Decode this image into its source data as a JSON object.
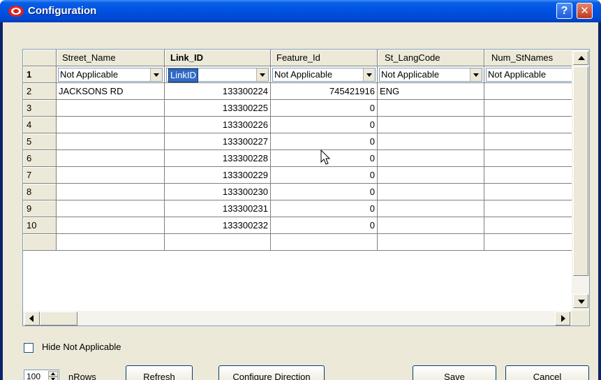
{
  "window": {
    "title": "Configuration",
    "help_label": "?",
    "close_label": "✕"
  },
  "grid": {
    "columns": [
      "Street_Name",
      "Link_ID",
      "Feature_Id",
      "St_LangCode",
      "Num_StNames"
    ],
    "mapping_row": {
      "row_number": "1",
      "values": [
        "Not Applicable",
        "LinkID",
        "Not Applicable",
        "Not Applicable",
        "Not Applicable"
      ]
    },
    "rows": [
      {
        "row_number": "2",
        "street_name": "JACKSONS RD",
        "link_id": "133300224",
        "feature_id": "745421916",
        "lang_code": "ENG"
      },
      {
        "row_number": "3",
        "street_name": "",
        "link_id": "133300225",
        "feature_id": "0",
        "lang_code": ""
      },
      {
        "row_number": "4",
        "street_name": "",
        "link_id": "133300226",
        "feature_id": "0",
        "lang_code": ""
      },
      {
        "row_number": "5",
        "street_name": "",
        "link_id": "133300227",
        "feature_id": "0",
        "lang_code": ""
      },
      {
        "row_number": "6",
        "street_name": "",
        "link_id": "133300228",
        "feature_id": "0",
        "lang_code": ""
      },
      {
        "row_number": "7",
        "street_name": "",
        "link_id": "133300229",
        "feature_id": "0",
        "lang_code": ""
      },
      {
        "row_number": "8",
        "street_name": "",
        "link_id": "133300230",
        "feature_id": "0",
        "lang_code": ""
      },
      {
        "row_number": "9",
        "street_name": "",
        "link_id": "133300231",
        "feature_id": "0",
        "lang_code": ""
      },
      {
        "row_number": "10",
        "street_name": "",
        "link_id": "133300232",
        "feature_id": "0",
        "lang_code": ""
      }
    ]
  },
  "controls": {
    "hide_not_applicable_label": "Hide Not Applicable",
    "nrows_value": "100",
    "nrows_label": "nRows",
    "refresh_label": "Refresh",
    "configure_direction_label": "Configure Direction",
    "save_label": "Save",
    "cancel_label": "Cancel"
  },
  "icons": {
    "app": "oracle-logo-icon",
    "help": "help-icon",
    "close": "close-icon",
    "dropdown": "chevron-down-icon",
    "cursor": "mouse-pointer-icon"
  },
  "colors": {
    "titlebar": "#0054e3",
    "selection": "#316ac5",
    "dialog_face": "#ece9d8",
    "close_button": "#c2391b"
  }
}
